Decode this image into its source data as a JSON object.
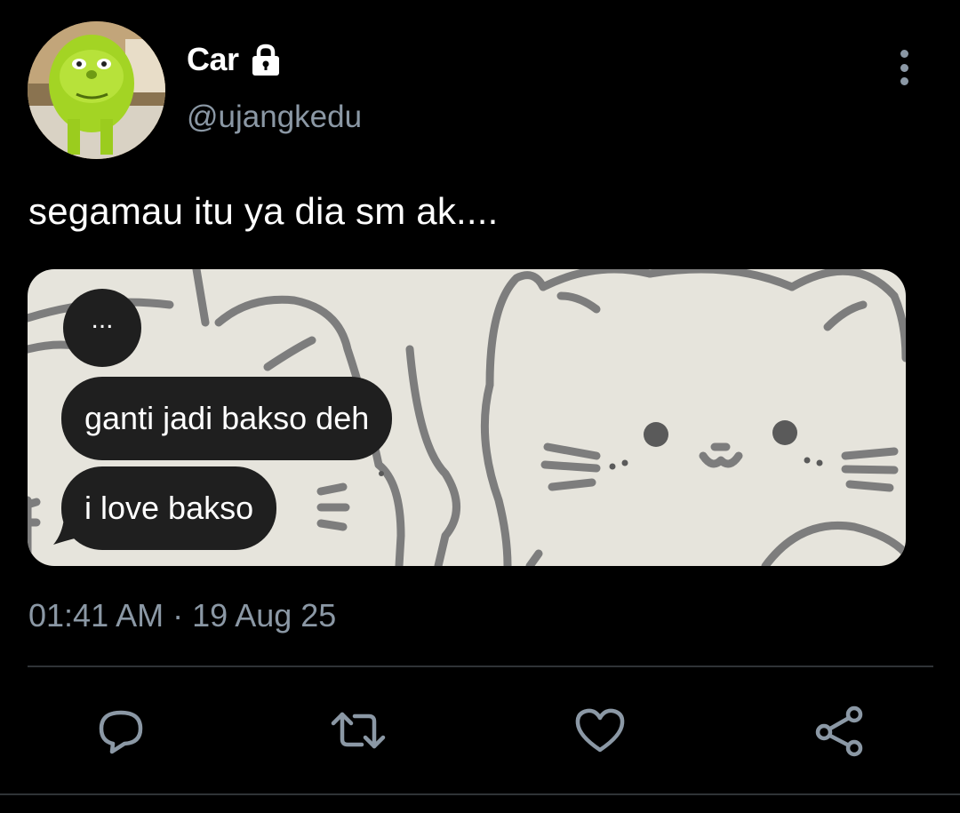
{
  "author": {
    "display_name": "Car",
    "handle": "@ujangkedu",
    "avatar_icon": "green-monster-avatar",
    "protected_icon": "lock-icon"
  },
  "tweet": {
    "text": "segamau itu ya dia sm ak....",
    "timestamp": "01:41 AM",
    "separator": "·",
    "date": "19 Aug 25"
  },
  "media": {
    "bubbles": [
      {
        "text": "..."
      },
      {
        "text": "ganti jadi bakso deh"
      },
      {
        "text": "i love bakso"
      }
    ],
    "background_color": "#e6e4dc",
    "line_color": "#7d7d7d"
  },
  "actions": [
    {
      "icon": "reply-icon"
    },
    {
      "icon": "retweet-icon"
    },
    {
      "icon": "like-icon"
    },
    {
      "icon": "share-icon"
    }
  ],
  "colors": {
    "background": "#000000",
    "primary_text": "#ffffff",
    "secondary_text": "#8b98a5",
    "divider": "#2f3336"
  }
}
